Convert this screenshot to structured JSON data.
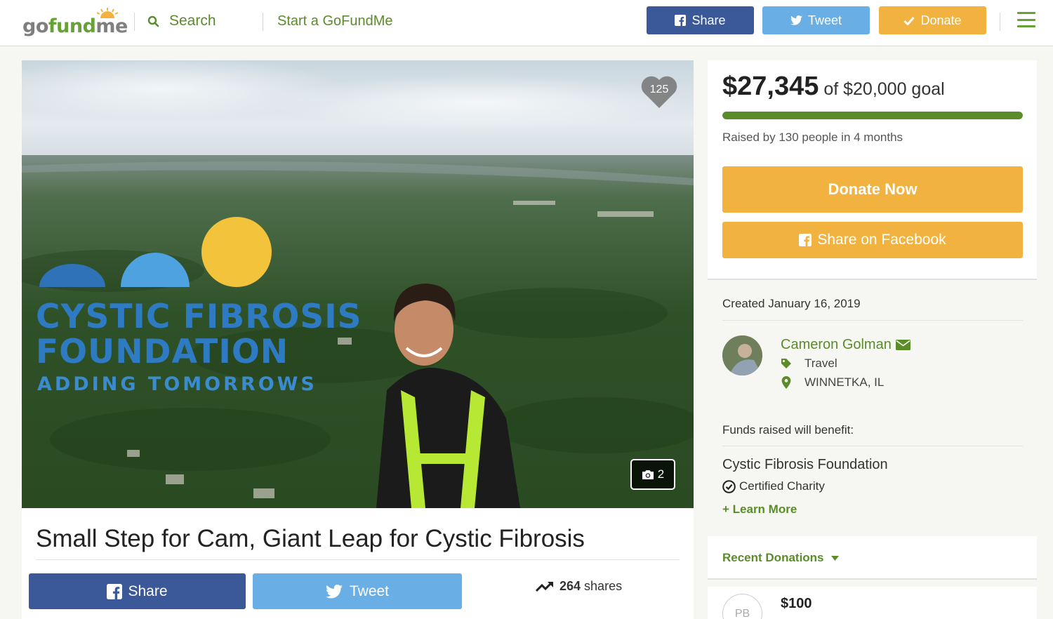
{
  "header": {
    "logo": {
      "go": "go",
      "fund": "fund",
      "me": "me"
    },
    "search_label": "Search",
    "start_label": "Start a GoFundMe",
    "share_label": "Share",
    "tweet_label": "Tweet",
    "donate_label": "Donate",
    "brand_green": "#66a235",
    "facebook_blue": "#3b5998",
    "twitter_blue": "#6aaee6",
    "donate_orange": "#f1b23f"
  },
  "hero": {
    "heart_count": "125",
    "photo_count": "2",
    "logo_text": {
      "line1": "CYSTIC FIBROSIS",
      "line2": "FOUNDATION",
      "line3": "ADDING TOMORROWS"
    }
  },
  "campaign": {
    "title": "Small Step for Cam, Giant Leap for Cystic Fibrosis",
    "share_label": "Share",
    "tweet_label": "Tweet",
    "shares_count": "264",
    "shares_suffix": " shares"
  },
  "donation": {
    "raised": "$27,345",
    "goal_text": " of $20,000 goal",
    "progress_percent": 100,
    "raised_by": "Raised by 130 people in 4 months",
    "donate_now": "Donate Now",
    "share_facebook": "Share on Facebook"
  },
  "organizer": {
    "created": "Created January 16, 2019",
    "name": "Cameron Golman",
    "category": "Travel",
    "location": "WINNETKA, IL",
    "benefit_label": "Funds raised will benefit:",
    "charity_name": "Cystic Fibrosis Foundation",
    "certified_label": "Certified Charity",
    "learn_more": "+ Learn More"
  },
  "recent": {
    "label": "Recent Donations",
    "items": [
      {
        "initials": "PB",
        "amount": "$100"
      }
    ]
  }
}
